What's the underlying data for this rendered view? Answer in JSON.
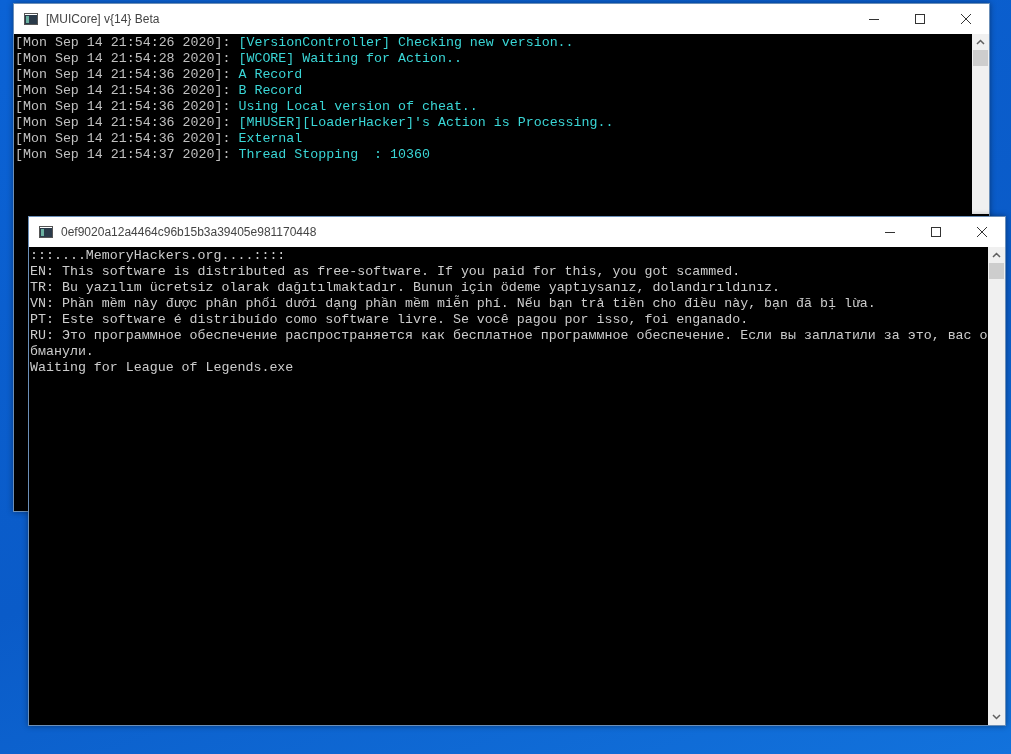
{
  "log_window": {
    "title": "[MUICore] v{14} Beta",
    "lines": [
      {
        "timestamp": "[Mon Sep 14 21:54:26 2020]:",
        "message": "[VersionController] Checking new version.."
      },
      {
        "timestamp": "[Mon Sep 14 21:54:28 2020]:",
        "message": "[WCORE] Waiting for Action.."
      },
      {
        "timestamp": "[Mon Sep 14 21:54:36 2020]:",
        "message": "A Record"
      },
      {
        "timestamp": "[Mon Sep 14 21:54:36 2020]:",
        "message": "B Record"
      },
      {
        "timestamp": "[Mon Sep 14 21:54:36 2020]:",
        "message": "Using Local version of cheat.."
      },
      {
        "timestamp": "[Mon Sep 14 21:54:36 2020]:",
        "message": "[MHUSER][LoaderHacker]'s Action is Processing.."
      },
      {
        "timestamp": "[Mon Sep 14 21:54:36 2020]:",
        "message": "External"
      },
      {
        "timestamp": "[Mon Sep 14 21:54:37 2020]:",
        "message": "Thread Stopping  : 10360"
      }
    ]
  },
  "notice_window": {
    "title": "0ef9020a12a4464c96b15b3a39405e981170448",
    "lines": [
      ":::....MemoryHackers.org....::::",
      "EN: This software is distributed as free-software. If you paid for this, you got scammed.",
      "TR: Bu yazılım ücretsiz olarak dağıtılmaktadır. Bunun için ödeme yaptıysanız, dolandırıldınız.",
      "VN: Phần mềm này được phân phối dưới dạng phần mềm miễn phí. Nếu bạn trả tiền cho điều này, bạn đã bị lừa.",
      "PT: Este software é distribuído como software livre. Se você pagou por isso, foi enganado.",
      "RU: Это программное обеспечение распространяется как бесплатное программное обеспечение. Если вы заплатили за это, вас обманули.",
      "Waiting for League of Legends.exe"
    ]
  }
}
